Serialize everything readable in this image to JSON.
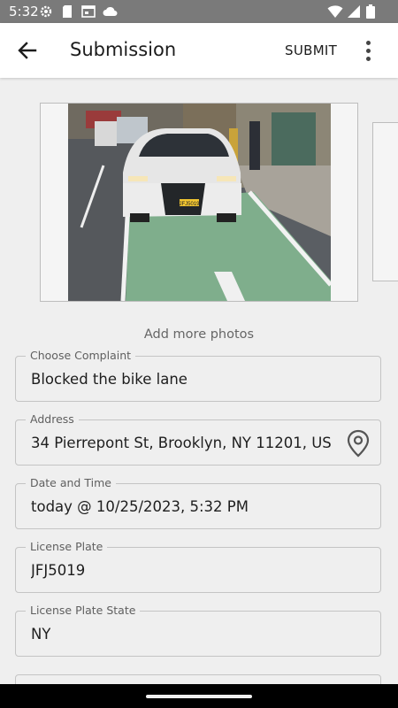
{
  "status_bar": {
    "time": "5:32"
  },
  "app_bar": {
    "title": "Submission",
    "submit_label": "SUBMIT"
  },
  "photo": {
    "add_more_label": "Add more photos",
    "plate_text": "JFJ5019"
  },
  "form": {
    "complaint": {
      "label": "Choose Complaint",
      "value": "Blocked the bike lane"
    },
    "address": {
      "label": "Address",
      "value": "34 Pierrepont St, Brooklyn, NY 11201, USA"
    },
    "datetime": {
      "label": "Date and Time",
      "value": "today @ 10/25/2023, 5:32 PM"
    },
    "license_plate": {
      "label": "License Plate",
      "value": "JFJ5019"
    },
    "plate_state": {
      "label": "License Plate State",
      "value": "NY"
    }
  },
  "colors": {
    "status_bar": "#7a7a7a",
    "app_bar": "#ffffff",
    "background": "#efefef",
    "bike_lane": "#7fae8c"
  },
  "icons": [
    "settings-icon",
    "sd-card-icon",
    "calendar-icon",
    "cloud-icon",
    "wifi-icon",
    "signal-icon",
    "battery-icon",
    "arrow-back-icon",
    "more-vert-icon",
    "location-pin-icon"
  ]
}
